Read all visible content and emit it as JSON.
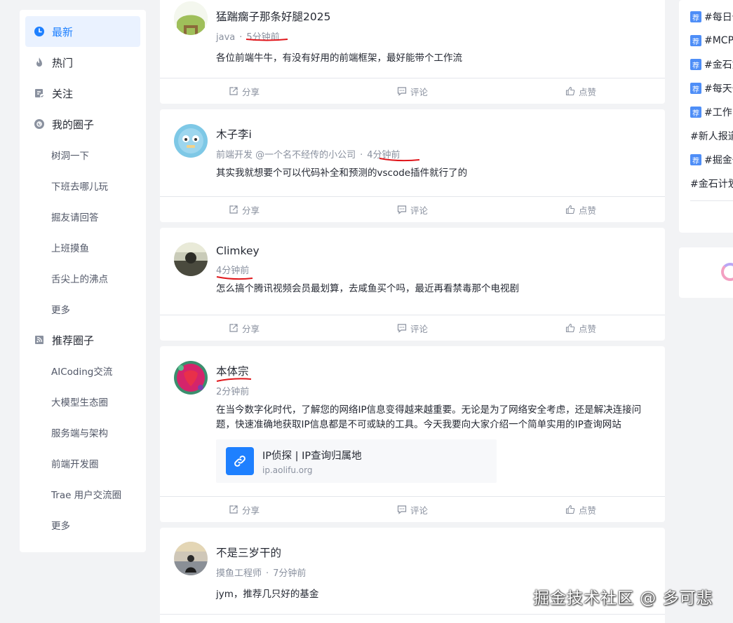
{
  "sidebar": {
    "main": [
      {
        "label": "最新",
        "icon": "clock-icon",
        "active": true
      },
      {
        "label": "热门",
        "icon": "fire-icon"
      },
      {
        "label": "关注",
        "icon": "follow-icon"
      },
      {
        "label": "我的圈子",
        "icon": "circle-icon"
      }
    ],
    "my_circles": [
      "树洞一下",
      "下班去哪儿玩",
      "掘友请回答",
      "上班摸鱼",
      "舌尖上的沸点",
      "更多"
    ],
    "recommended_title": "推荐圈子",
    "recommended": [
      "AICoding交流",
      "大模型生态圈",
      "服务端与架构",
      "前端开发圈",
      "Trae 用户交流圈",
      "更多"
    ]
  },
  "actions": {
    "share": "分享",
    "comment": "评论",
    "like": "点赞"
  },
  "posts": [
    {
      "name": "猛踹瘸子那条好腿2025",
      "meta1": "java",
      "meta2": "5分钟前",
      "content": "各位前端牛牛，有没有好用的前端框架，最好能带个工作流"
    },
    {
      "name": "木子李i",
      "meta1": "前端开发 @一个名不经传的小公司",
      "meta2": "4分钟前",
      "content": "其实我就想要个可以代码补全和预测的vscode插件就行了的"
    },
    {
      "name": "Climkey",
      "meta1": "",
      "meta2": "4分钟前",
      "content": "怎么搞个腾讯视频会员最划算，去咸鱼买个吗，最近再看禁毒那个电视剧"
    },
    {
      "name": "本体宗",
      "meta1": "",
      "meta2": "2分钟前",
      "content": "在当今数字化时代，了解您的网络IP信息变得越来越重要。无论是为了网络安全考虑，还是解决连接问题，快速准确地获取IP信息都是不可或缺的工具。今天我要向大家介绍一个简单实用的IP查询网站",
      "link": {
        "title": "IP侦探 | IP查询归属地",
        "url": "ip.aolifu.org"
      }
    },
    {
      "name": "不是三岁干的",
      "meta1": "摸鱼工程师",
      "meta2": "7分钟前",
      "content": "jym，推荐几只好的基金"
    }
  ],
  "right_topics": [
    {
      "tag": "荐",
      "label": "#每日竹"
    },
    {
      "tag": "荐",
      "label": "#MCP"
    },
    {
      "tag": "荐",
      "label": "#金石如"
    },
    {
      "tag": "荐",
      "label": "#每天一"
    },
    {
      "tag": "荐",
      "label": "#工作中"
    },
    {
      "tag": "",
      "label": "#新人报道"
    },
    {
      "tag": "荐",
      "label": "#掘金一"
    },
    {
      "tag": "",
      "label": "#金石计划"
    }
  ],
  "watermark": "掘金技术社区 @ 多可悲",
  "colors": {
    "accent": "#1e80ff",
    "annotation_red": "#e0161b"
  }
}
